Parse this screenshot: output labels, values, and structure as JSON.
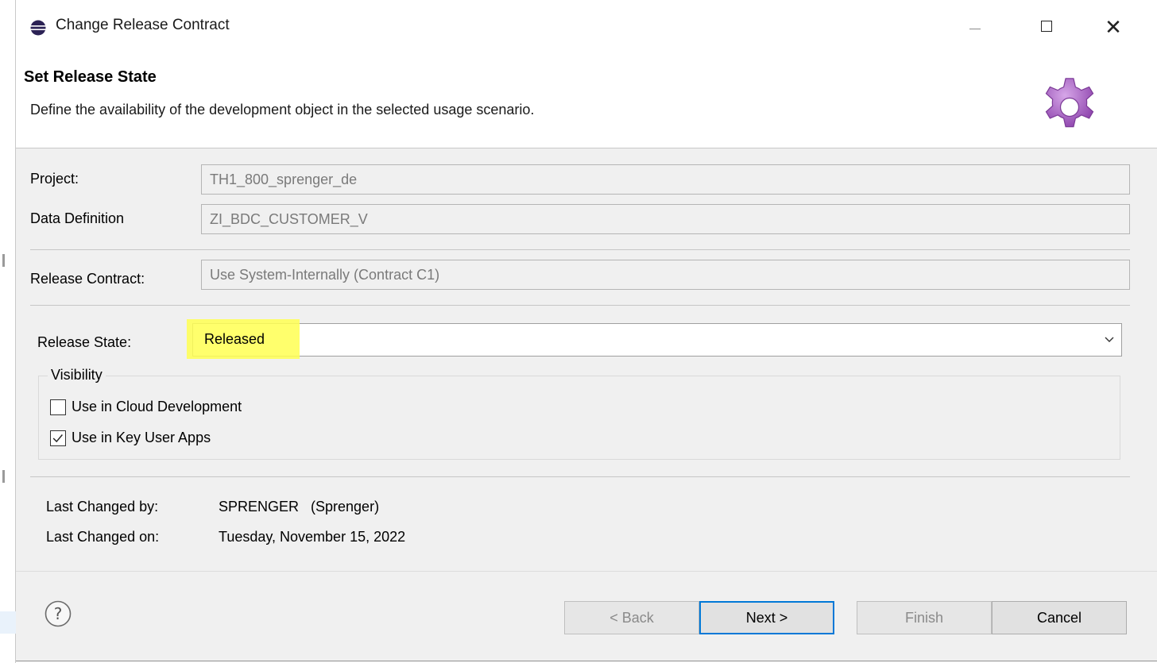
{
  "window": {
    "title": "Change Release Contract",
    "close_glyph": "✕"
  },
  "banner": {
    "title": "Set Release State",
    "description": "Define the availability of the development object in the selected usage scenario.",
    "icon": "gear-icon",
    "icon_color": "#9b59b6"
  },
  "form": {
    "project_label": "Project:",
    "project_value": "TH1_800_sprenger_de",
    "data_definition_label": "Data Definition",
    "data_definition_value": "ZI_BDC_CUSTOMER_V",
    "release_contract_label": "Release Contract:",
    "release_contract_value": "Use System-Internally (Contract C1)",
    "release_state_label": "Release State:",
    "release_state_value": "Released"
  },
  "visibility": {
    "legend": "Visibility",
    "options": [
      {
        "label": "Use in Cloud Development",
        "checked": false
      },
      {
        "label": "Use in Key User Apps",
        "checked": true
      }
    ]
  },
  "last_changed": {
    "by_label": "Last Changed by:",
    "by_value": "SPRENGER   (Sprenger)",
    "on_label": "Last Changed on:",
    "on_value": "Tuesday, November 15, 2022"
  },
  "buttons": {
    "back": "< Back",
    "next": "Next >",
    "finish": "Finish",
    "cancel": "Cancel"
  },
  "colors": {
    "highlight": "#ffff52",
    "default_button_border": "#0078d7"
  }
}
